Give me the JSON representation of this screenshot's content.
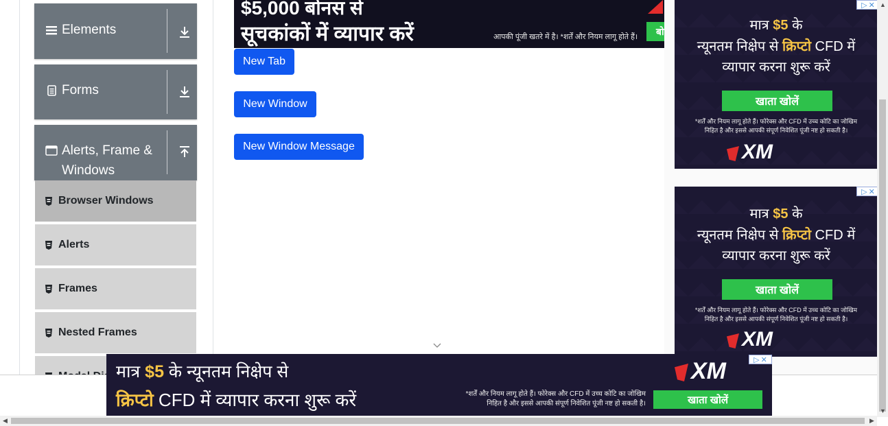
{
  "sidebar": {
    "groups": [
      {
        "label": "Elements",
        "icon": "list-icon",
        "toggle_icon": "download-arrow-icon"
      },
      {
        "label": "Forms",
        "icon": "document-icon",
        "toggle_icon": "download-arrow-icon"
      },
      {
        "label_line1": "Alerts, Frame &",
        "label_line2": "Windows",
        "icon": "window-icon",
        "toggle_icon": "upload-arrow-icon"
      }
    ],
    "items": [
      {
        "label": "Browser Windows",
        "active": true
      },
      {
        "label": "Alerts"
      },
      {
        "label": "Frames"
      },
      {
        "label": "Nested Frames"
      },
      {
        "label": "Modal Dialogs"
      }
    ]
  },
  "main": {
    "buttons": {
      "new_tab": "New Tab",
      "new_window": "New Window",
      "new_window_message": "New Window Message"
    }
  },
  "ads": {
    "top": {
      "line1": "$5,000 बोनस से",
      "line2": "सूचकांकों में व्यापार करें",
      "disclaimer": "आपकी पूंजी खतरे में है। *शर्तें और नियम लागू होते हैं।",
      "cta": "बो"
    },
    "side": {
      "line1_pre": "मात्र ",
      "line1_amount": "$5",
      "line1_post": " के",
      "line2_pre": "न्यूनतम निक्षेप से ",
      "line2_hl": "क्रिप्टो",
      "line2_post": " CFD में",
      "line3": "व्यापार करना शुरू करें",
      "cta": "खाता खोलें",
      "disclaimer1": "*शर्तें और नियम लागू होते हैं। फोरेक्स और CFD में उच्च कोटि का जोखिम",
      "disclaimer2": "निहित है और इससे आपकी संपूर्ण निवेशित पूंजी नष्ट हो सकती है।",
      "logo": "XM"
    },
    "bottom": {
      "line1_pre": "मात्र ",
      "line1_amount": "$5",
      "line1_post": " के न्यूनतम निक्षेप से",
      "line2_hl": "क्रिप्टो",
      "line2_post": " CFD में व्यापार करना शुरू करें",
      "disclaimer1": "*शर्तें और नियम लागू होते हैं। फोरेक्स और CFD में उच्च कोटि का जोखिम",
      "disclaimer2": "निहित है और इससे आपकी संपूर्ण निवेशित पूंजी नष्ट हो सकती है।",
      "cta": "खाता खोलें",
      "logo": "XM"
    }
  },
  "colors": {
    "primary_button": "#1058f0",
    "group_header": "#6c757d",
    "menu_item": "#d4d4d4",
    "menu_item_active": "#b8b8b8",
    "ad_bg": "#1c1833",
    "ad_cta": "#2ec14b"
  }
}
